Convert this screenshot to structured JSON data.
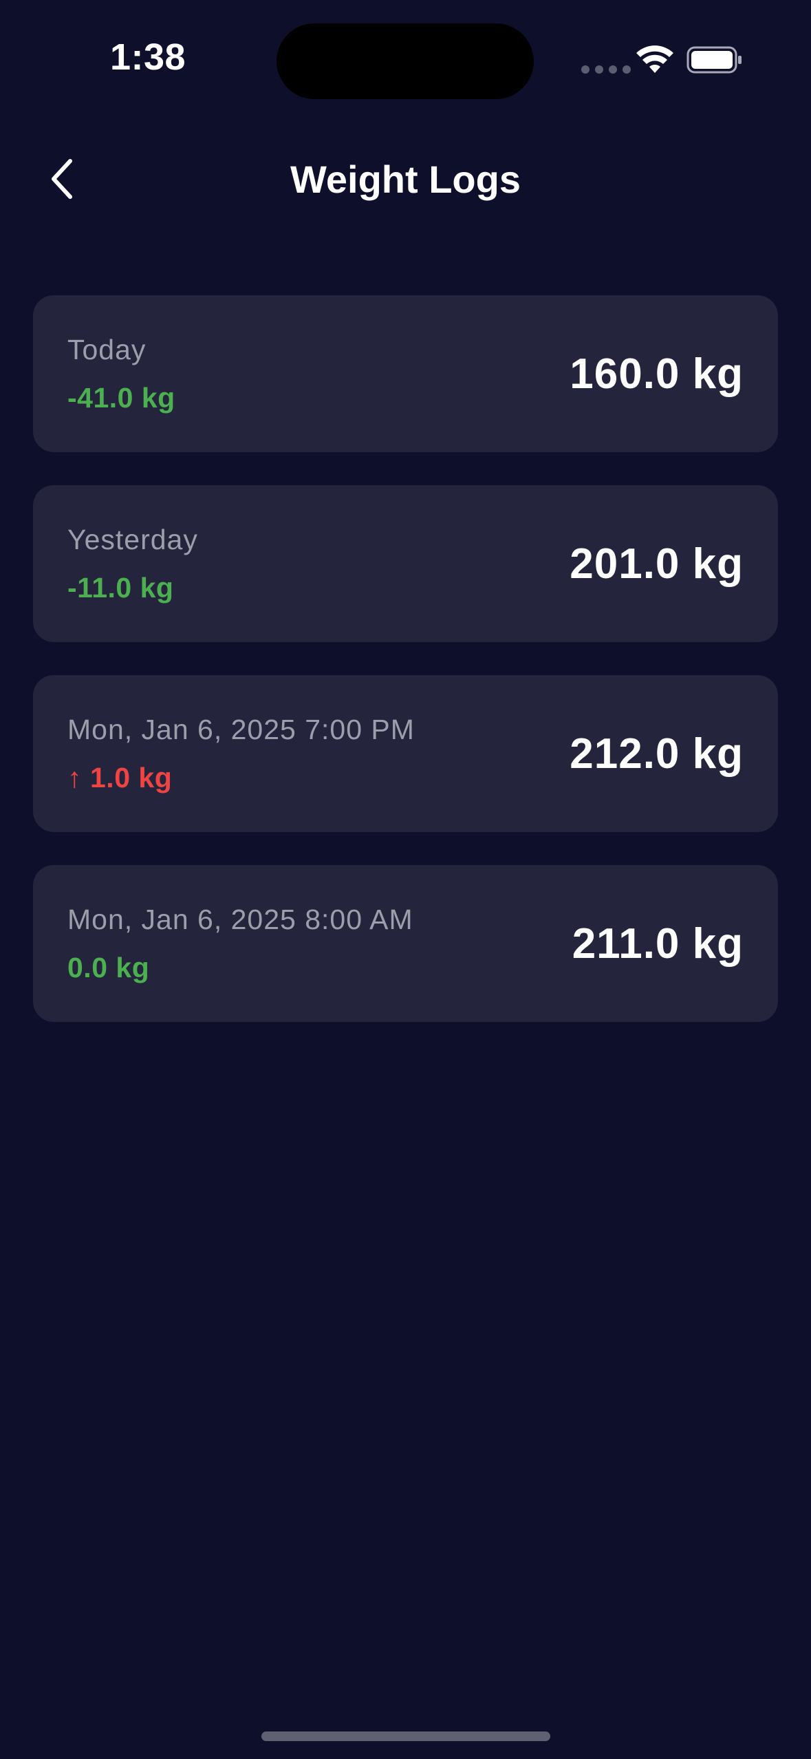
{
  "status_bar": {
    "time": "1:38"
  },
  "header": {
    "title": "Weight Logs",
    "back_icon": "chevron-left-icon"
  },
  "logs": [
    {
      "date": "Today",
      "change": "-41.0 kg",
      "direction": "down",
      "weight": "160.0 kg"
    },
    {
      "date": "Yesterday",
      "change": "-11.0 kg",
      "direction": "down",
      "weight": "201.0 kg"
    },
    {
      "date": "Mon, Jan 6, 2025 7:00 PM",
      "change": "1.0 kg",
      "direction": "up",
      "weight": "212.0 kg"
    },
    {
      "date": "Mon, Jan 6, 2025 8:00 AM",
      "change": "0.0 kg",
      "direction": "flat",
      "weight": "211.0 kg"
    }
  ],
  "colors": {
    "background": "#0e0f2b",
    "card": "#24253d",
    "decrease": "#4caf50",
    "increase": "#ef4444"
  }
}
